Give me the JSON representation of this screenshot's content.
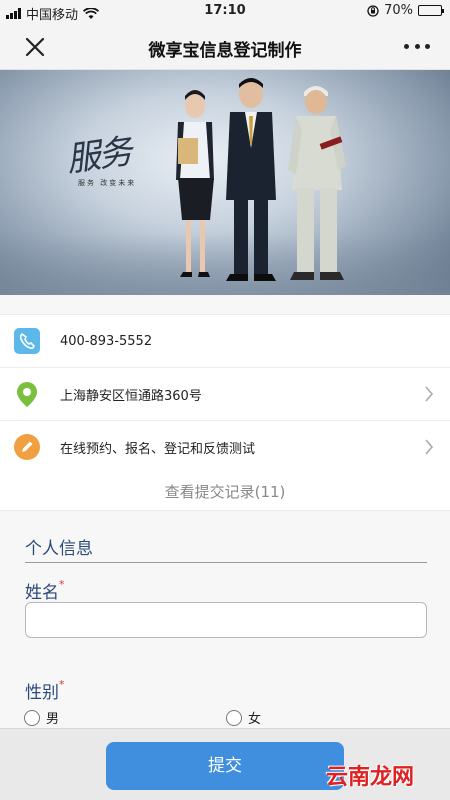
{
  "status_bar": {
    "carrier": "中国移动",
    "time": "17:10",
    "battery_text": "70%",
    "battery_level": 0.7
  },
  "nav": {
    "title": "微享宝信息登记制作",
    "close_icon": "close-icon",
    "more_icon": "more-icon"
  },
  "banner": {
    "calligraphy": "服务",
    "slogan": "服务    改变未来"
  },
  "contacts": [
    {
      "icon": "phone-icon",
      "text": "400-893-5552",
      "color": "#5bb8e8",
      "has_arrow": false
    },
    {
      "icon": "location-pin-icon",
      "text": "上海静安区恒通路360号",
      "color": "#7bbf3f",
      "has_arrow": true
    },
    {
      "icon": "pencil-icon",
      "text": "在线预约、报名、登记和反馈测试",
      "color": "#f0a040",
      "has_arrow": true
    }
  ],
  "record_link": "查看提交记录(11)",
  "form": {
    "section_title": "个人信息",
    "name_label": "姓名",
    "name_value": "",
    "gender_label": "性别",
    "required_mark": "*",
    "gender_options": [
      "男",
      "女"
    ]
  },
  "submit_label": "提交",
  "watermark": "云南龙网",
  "colors": {
    "accent": "#3f8fde",
    "label": "#2b4b7a",
    "required": "#d33333"
  }
}
